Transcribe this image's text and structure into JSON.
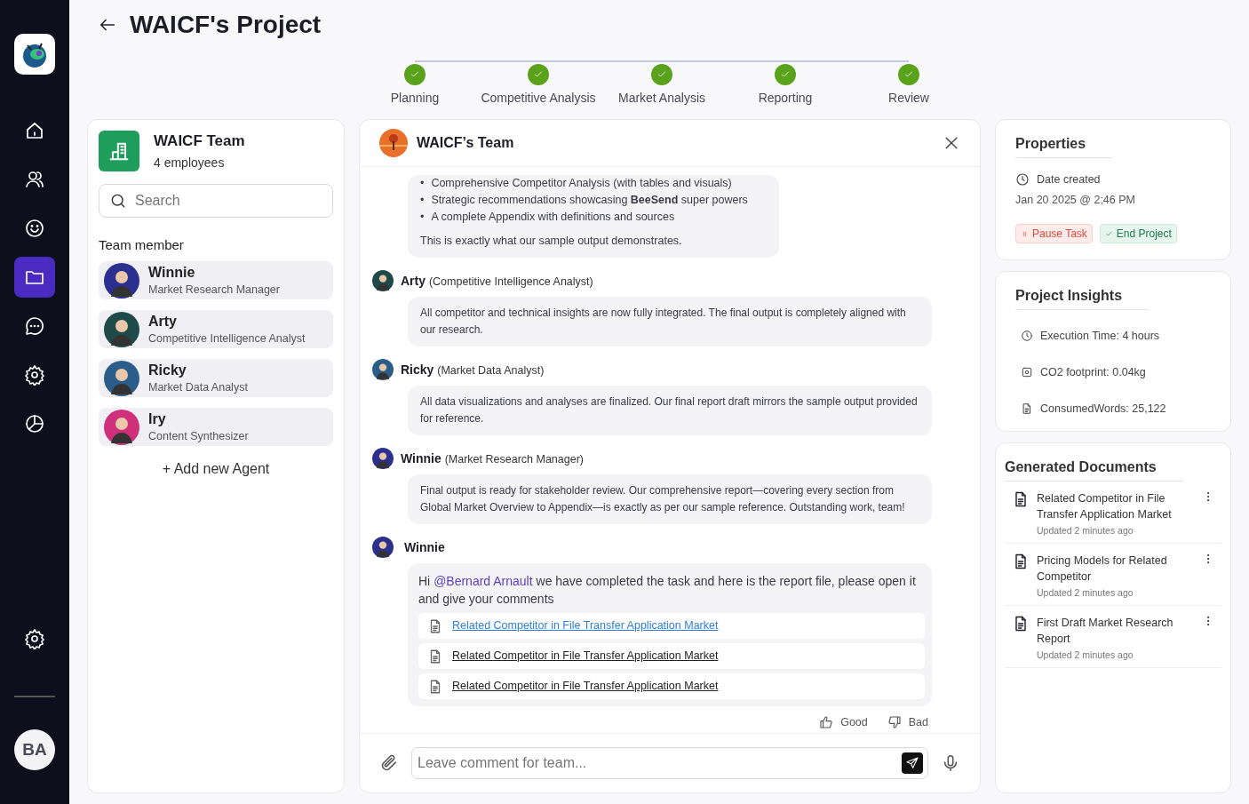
{
  "nav": {
    "items": [
      {
        "selected": false
      },
      {
        "selected": false
      },
      {
        "selected": false
      },
      {
        "selected": true
      },
      {
        "selected": false
      },
      {
        "selected": false
      },
      {
        "selected": false
      }
    ],
    "user": {
      "initials": "BA"
    }
  },
  "project": {
    "title": "WAICF's Project"
  },
  "stepper": [
    {
      "label": "Planning",
      "done": true
    },
    {
      "label": "Competitive Analysis",
      "done": true
    },
    {
      "label": "Market Analysis",
      "done": true
    },
    {
      "label": "Reporting",
      "done": true
    },
    {
      "label": "Review",
      "done": true
    }
  ],
  "team": {
    "name": "WAICF Team",
    "count": "4 employees",
    "search": {
      "placeholder": "Search"
    },
    "section": "Team member",
    "add_label": "+ Add new Agent",
    "members": [
      {
        "name": "Winnie",
        "role": "Market Research Manager"
      },
      {
        "name": "Arty",
        "role": "Competitive Intelligence Analyst"
      },
      {
        "name": "Ricky",
        "role": "Market Data Analyst"
      },
      {
        "name": "Iry",
        "role": "Content Synthesizer"
      }
    ]
  },
  "chat": {
    "title": "WAICF’s Team",
    "messages": [
      {
        "kind": "summary",
        "marker": "•",
        "bullets": [
          "Comprehensive Competitor Analysis (with tables and visuals)",
          "Strategic recommendations showcasing **BeeSend** super powers",
          "A complete Appendix with definitions and sources"
        ],
        "text": "This is exactly what our sample output demonstrates."
      },
      {
        "kind": "post",
        "author": "Arty",
        "role": "(Competitive Intelligence Analyst)",
        "text": "All competitor and technical insights are now fully integrated. The final output is completely aligned with our research."
      },
      {
        "kind": "post",
        "author": "Ricky",
        "role": "(Market Data Analyst)",
        "text": "All data visualizations and analyses are finalized. Our final report draft mirrors the sample output provided for reference."
      },
      {
        "kind": "post",
        "author": "Winnie",
        "role": "(Market Research Manager)",
        "text": "Final output is ready for stakeholder review. Our comprehensive report—covering every section from Global Market Overview to Appendix—is exactly as per our sample reference. Outstanding work, team!"
      },
      {
        "kind": "report",
        "author": "Winnie",
        "before": "Hi ",
        "mention": "@Bernard Arnault",
        "after": " we have completed the task and here is the report file, please open it and give your comments",
        "files": [
          {
            "title": "Related Competitor in File Transfer Application Market",
            "hovered": true
          },
          {
            "title": "Related Competitor in File Transfer Application Market",
            "hovered": false
          },
          {
            "title": "Related Competitor in File Transfer Application Market",
            "hovered": false
          }
        ]
      }
    ],
    "feedback": [
      {
        "label": "Good",
        "kind": "up"
      },
      {
        "label": "Bad",
        "kind": "down"
      }
    ],
    "composer": {
      "placeholder": "Leave comment for team..."
    }
  },
  "properties": {
    "title": "Properties",
    "date_label": "Date created",
    "date": "Jan 20 2025 @ 2;46 PM",
    "actions": [
      {
        "label": "Pause Task",
        "kind": "pause"
      },
      {
        "label": "End Project",
        "kind": "end"
      }
    ]
  },
  "insights": {
    "title": "Project Insights",
    "items": [
      {
        "text": "Execution Time: 4 hours",
        "kind": "time"
      },
      {
        "text": "CO2 footprint: 0.04kg",
        "kind": "co2"
      },
      {
        "text": "ConsumedWords: 25,122",
        "kind": "words"
      }
    ]
  },
  "documents": {
    "title": "Generated Documents",
    "items": [
      {
        "title": "Related Competitor in File Transfer Application Market",
        "updated": "Updated 2 minutes ago"
      },
      {
        "title": "Pricing Models for Related Competitor",
        "updated": "Updated 2 minutes ago"
      },
      {
        "title": "First Draft Market Research Report",
        "updated": "Updated 2 minutes ago"
      }
    ]
  }
}
